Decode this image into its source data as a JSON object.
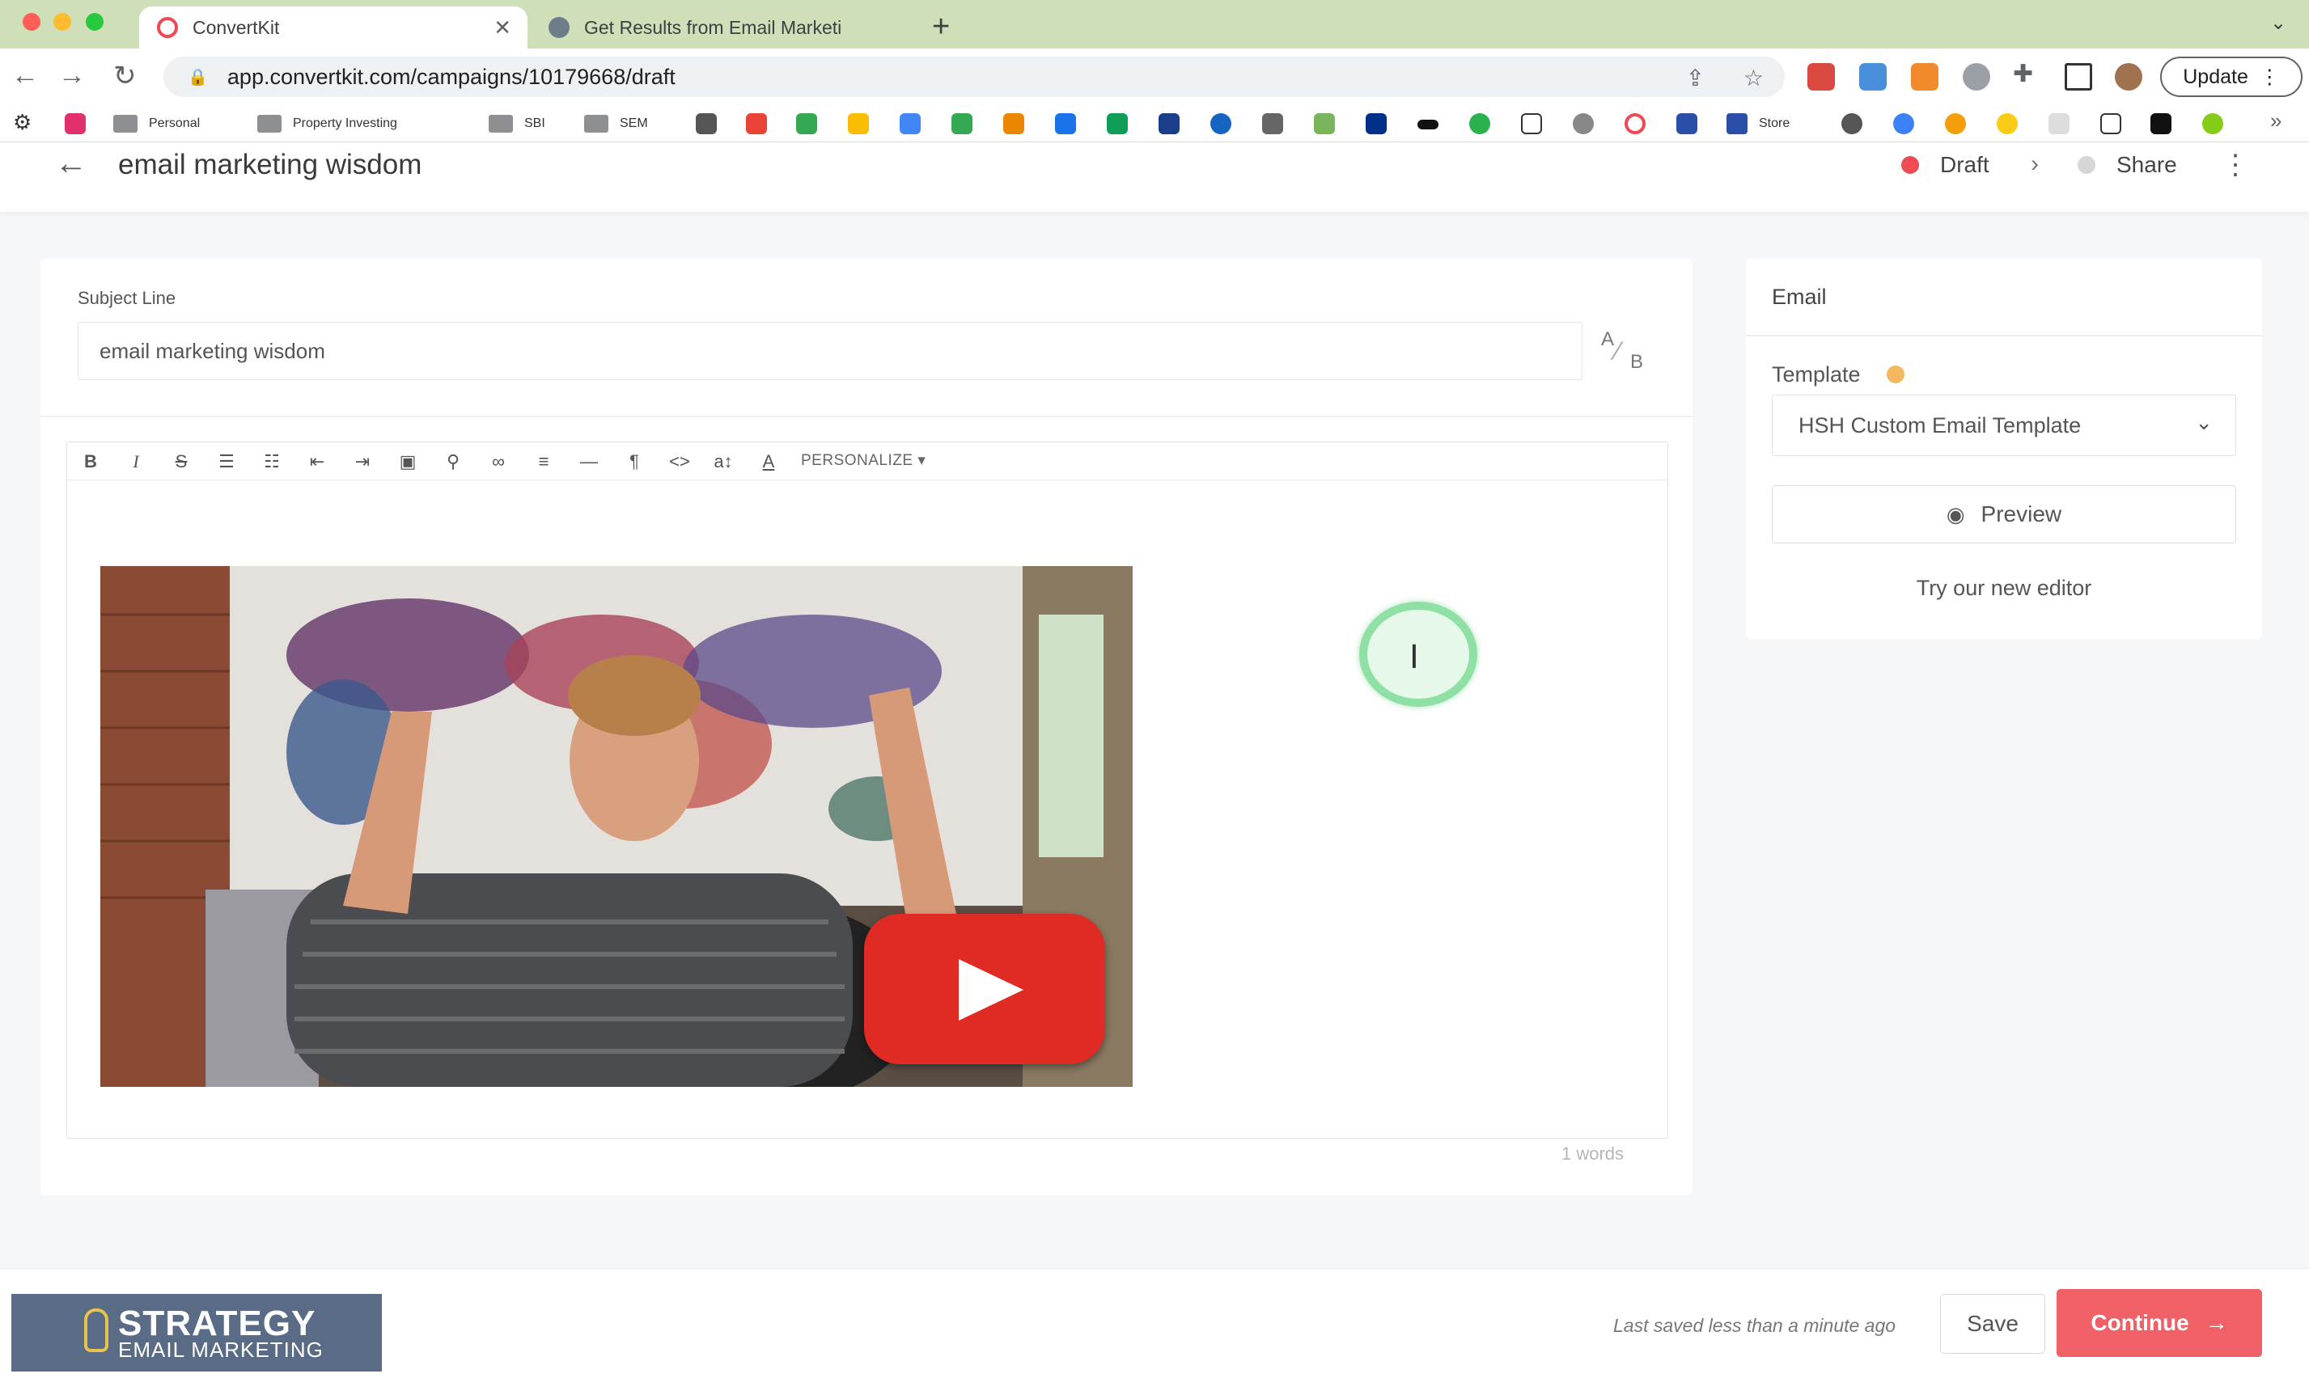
{
  "browser": {
    "tabs": [
      {
        "title": "ConvertKit",
        "active": true
      },
      {
        "title": "Get Results from Email Marketi",
        "active": false
      }
    ],
    "url": "app.convertkit.com/campaigns/10179668/draft",
    "update_label": "Update",
    "bookmarks": [
      "Personal",
      "Property Investing",
      "SBI",
      "SEM",
      "Store"
    ],
    "traffic_colors": [
      "#ff5f57",
      "#febc2e",
      "#28c840"
    ]
  },
  "header": {
    "title": "email marketing wisdom",
    "status_draft": "Draft",
    "status_share": "Share",
    "draft_color": "#ef4b55"
  },
  "subject": {
    "label": "Subject Line",
    "value": "email marketing wisdom",
    "ab_a": "A",
    "ab_b": "B"
  },
  "editor": {
    "personalize_label": "PERSONALIZE",
    "word_count": "1 words",
    "toolbar_icons": [
      "bold-icon",
      "italic-icon",
      "strikethrough-icon",
      "bullet-list-icon",
      "numbered-list-icon",
      "outdent-icon",
      "indent-icon",
      "image-icon",
      "link-icon",
      "unlink-icon",
      "align-icon",
      "horizontal-rule-icon",
      "paragraph-icon",
      "code-icon",
      "text-size-icon",
      "text-color-icon"
    ]
  },
  "sidebar": {
    "title": "Email",
    "template_label": "Template",
    "template_value": "HSH Custom Email Template",
    "preview_label": "Preview",
    "try_editor_label": "Try our new editor"
  },
  "footer": {
    "logo_line1": "STRATEGY",
    "logo_line2": "EMAIL MARKETING",
    "last_saved": "Last saved less than a minute ago",
    "save_label": "Save",
    "continue_label": "Continue",
    "accent": "#ef6067"
  }
}
